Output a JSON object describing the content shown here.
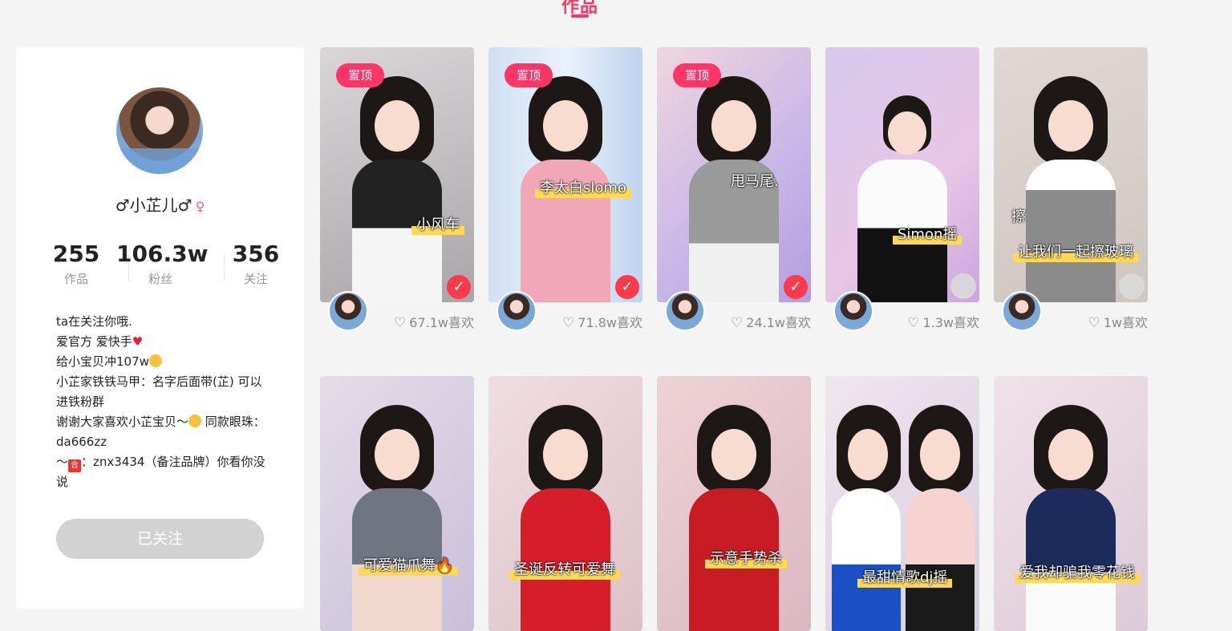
{
  "section_title": "作品",
  "profile": {
    "nickname": "♂小芷儿♂",
    "stats": [
      {
        "value": "255",
        "label": "作品"
      },
      {
        "value": "106.3w",
        "label": "粉丝"
      },
      {
        "value": "356",
        "label": "关注"
      }
    ],
    "bio": {
      "line1": "ta在关注你哦.",
      "line2": "爱官方 爱快手",
      "line3": "给小宝贝冲107w",
      "line4": "小芷家铁铁马甲：名字后面带(芷) 可以进铁粉群",
      "line5a": "谢谢大家喜欢小芷宝贝～",
      "line5b": " 同款眼珠：da666zz",
      "line6a": "～",
      "line6b": "：znx3434（备注品牌）你看你没说"
    },
    "follow_button": "已关注"
  },
  "videos": [
    {
      "pinned": "置顶",
      "caption": "小风车",
      "likes": "67.1w喜欢",
      "selected": true
    },
    {
      "pinned": "置顶",
      "caption": "李太白slomo",
      "likes": "71.8w喜欢",
      "selected": true
    },
    {
      "pinned": "置顶",
      "caption": "甩马尾.",
      "likes": "24.1w喜欢",
      "selected": true
    },
    {
      "caption": "Simon摇",
      "likes": "1.3w喜欢",
      "selected": false
    },
    {
      "caption": "让我们一起擦玻璃",
      "caption2": "擦",
      "likes": "1w喜欢",
      "selected": false
    },
    {
      "caption": "可爱猫爪舞🔥"
    },
    {
      "caption": "圣诞反转可爱舞"
    },
    {
      "caption": "示意手势杀"
    },
    {
      "caption": "最甜情歌dj摇"
    },
    {
      "caption": "爱我却骗我零花钱"
    }
  ]
}
